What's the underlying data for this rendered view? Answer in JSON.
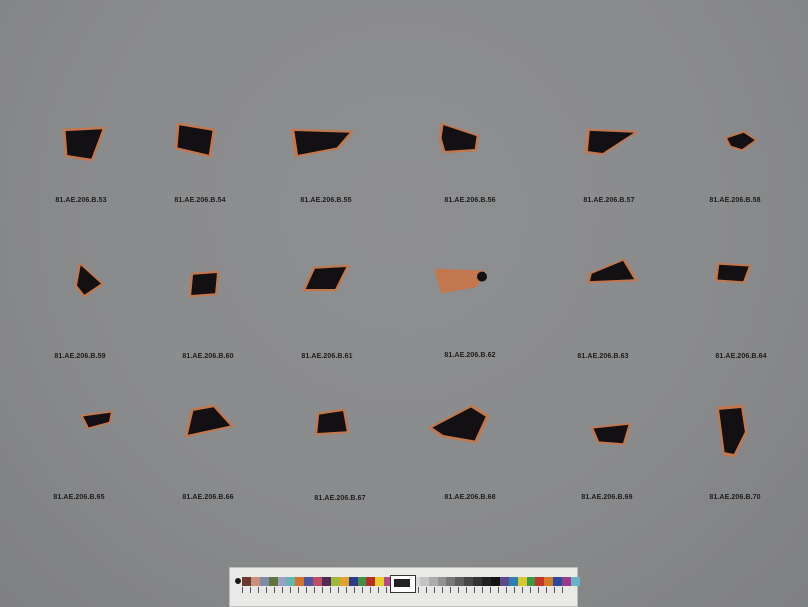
{
  "photo": {
    "background": "#8b8c8e",
    "shard_colors": {
      "glaze": "#121012",
      "clay": "#c2774e"
    }
  },
  "fragments": [
    {
      "label": "81.AE.206.B.53",
      "type": "black"
    },
    {
      "label": "81.AE.206.B.54",
      "type": "black"
    },
    {
      "label": "81.AE.206.B.55",
      "type": "black"
    },
    {
      "label": "81.AE.206.B.56",
      "type": "black"
    },
    {
      "label": "81.AE.206.B.57",
      "type": "black"
    },
    {
      "label": "81.AE.206.B.58",
      "type": "black"
    },
    {
      "label": "81.AE.206.B.59",
      "type": "black"
    },
    {
      "label": "81.AE.206.B.60",
      "type": "black"
    },
    {
      "label": "81.AE.206.B.61",
      "type": "black"
    },
    {
      "label": "81.AE.206.B.62",
      "type": "terracotta"
    },
    {
      "label": "81.AE.206.B.63",
      "type": "black"
    },
    {
      "label": "81.AE.206.B.64",
      "type": "black"
    },
    {
      "label": "81.AE.206.B.65",
      "type": "black"
    },
    {
      "label": "81.AE.206.B.66",
      "type": "black"
    },
    {
      "label": "81.AE.206.B.67",
      "type": "black"
    },
    {
      "label": "81.AE.206.B.68",
      "type": "black"
    },
    {
      "label": "81.AE.206.B.69",
      "type": "black"
    },
    {
      "label": "81.AE.206.B.70",
      "type": "black"
    }
  ],
  "color_card": {
    "swatches": [
      "#6b3a2c",
      "#c8917c",
      "#7d8aa8",
      "#61743c",
      "#9aa0c8",
      "#60b6b0",
      "#d3742e",
      "#4b56a0",
      "#c04d5e",
      "#4c2a5a",
      "#9fb83a",
      "#e0a22d",
      "#2d3a8a",
      "#3f8f46",
      "#b72d2a",
      "#e6cd2a",
      "#b8488e",
      "#2a86b8",
      "#f2f2f2",
      "#d9d9d9",
      "#c4c4c4",
      "#ababab",
      "#929292",
      "#777777",
      "#5e5e5e",
      "#474747",
      "#333333",
      "#202020",
      "#121212",
      "#5a4a8a",
      "#2f7fb0",
      "#d8c72c",
      "#3a9a4a",
      "#c3362a",
      "#d07a2a",
      "#2a4a9a",
      "#9a3a8a",
      "#6ab0c8"
    ]
  }
}
